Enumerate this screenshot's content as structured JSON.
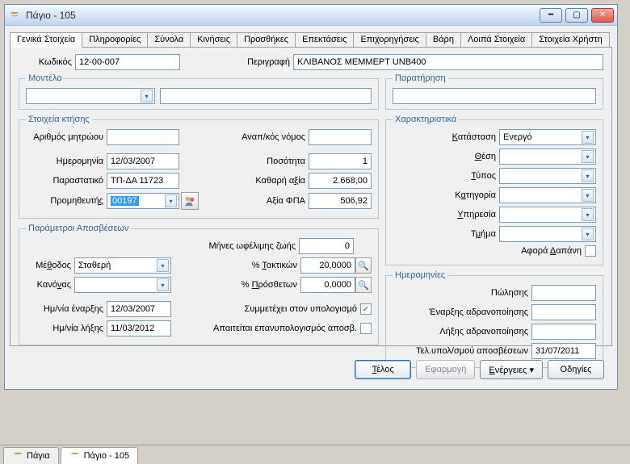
{
  "window": {
    "title": "Πάγιο - 105"
  },
  "tabs": [
    "Γενικά Στοιχεία",
    "Πληροφορίες",
    "Σύνολα",
    "Κινήσεις",
    "Προσθήκες",
    "Επεκτάσεις",
    "Επιχορηγήσεις",
    "Βάρη",
    "Λοιπά Στοιχεία",
    "Στοιχεία Χρήστη"
  ],
  "active_tab_index": 0,
  "header": {
    "code_label": "Κωδικός",
    "code_value": "12-00-007",
    "desc_label": "Περιγραφή",
    "desc_value": "ΚΛΙΒΑΝΟΣ MEMMEPT UNB400"
  },
  "model": {
    "legend": "Μοντέλο",
    "select_value": "",
    "text_value": ""
  },
  "observation": {
    "legend": "Παρατήρηση",
    "value": ""
  },
  "acquisition": {
    "legend": "Στοιχεία κτήσης",
    "registry_label": "Αριθμός μητρώου",
    "registry_value": "",
    "law_label": "Αναπ/κός νόμος",
    "law_value": "",
    "date_label": "Ημερομηνία",
    "date_value": "12/03/2007",
    "qty_label": "Ποσότητα",
    "qty_value": "1",
    "doc_label": "Παραστατικό",
    "doc_value": "ΤΠ-ΔΑ 11723",
    "net_label": "Καθαρή αξία",
    "net_value": "2.668,00",
    "supplier_label": "Προμηθευτής",
    "supplier_value": "00197",
    "vat_label": "Αξία ΦΠΑ",
    "vat_value": "506,92"
  },
  "attributes": {
    "legend": "Χαρακτηριστικά",
    "status_label": "Κατάσταση",
    "status_value": "Ενεργό",
    "position_label": "Θέση",
    "position_value": "",
    "type_label": "Τύπος",
    "type_value": "",
    "category_label": "Κατηγορία",
    "category_value": "",
    "service_label": "Υπηρεσία",
    "service_value": "",
    "department_label": "Τμήμα",
    "department_value": "",
    "expense_label": "Αφορά Δαπάνη",
    "expense_checked": false
  },
  "depreciation": {
    "legend": "Παράμετροι Αποσβέσεων",
    "method_label": "Μέθοδος",
    "method_value": "Σταθερή",
    "rule_label": "Κανόνας",
    "rule_value": "",
    "months_label": "Μήνες ωφέλιμης ζωής",
    "months_value": "0",
    "regular_pct_label": "% Τακτικών",
    "regular_pct_value": "20,0000",
    "extra_pct_label": "% Πρόσθετων",
    "extra_pct_value": "0,0000",
    "start_date_label": "Ημ/νία έναρξης",
    "start_date_value": "12/03/2007",
    "end_date_label": "Ημ/νία λήξης",
    "end_date_value": "11/03/2012",
    "participates_label": "Συμμετέχει στον υπολογισμό",
    "participates_checked": true,
    "recalc_label": "Απαιτείται επανυπολογισμός αποσβ.",
    "recalc_checked": false
  },
  "dates": {
    "legend": "Ημερομηνίες",
    "sale_label": "Πώλησης",
    "sale_value": "",
    "inactivation_start_label": "Έναρξης αδρανοποίησης",
    "inactivation_start_value": "",
    "inactivation_end_label": "Λήξης αδρανοποίησης",
    "inactivation_end_value": "",
    "last_calc_label": "Τελ.υπολ/σμού αποσβέσεων",
    "last_calc_value": "31/07/2011"
  },
  "buttons": {
    "close": "Τέλος",
    "apply": "Εφαρμογή",
    "actions": "Ενέργειες",
    "help": "Οδηγίες"
  },
  "taskbar": {
    "tab1": "Πάγια",
    "tab2": "Πάγιο - 105"
  }
}
